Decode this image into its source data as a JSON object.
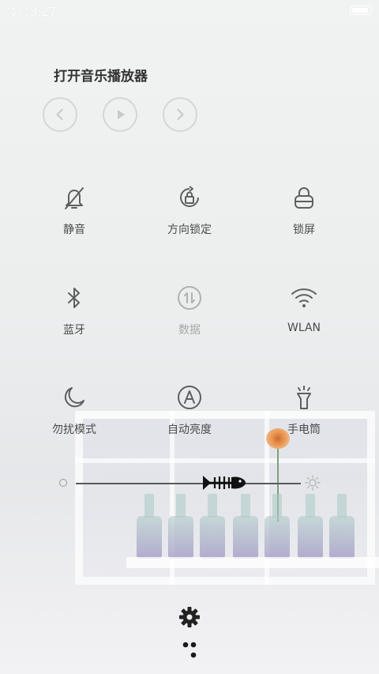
{
  "status_bar": {
    "time": "凌晨3:27",
    "battery_level": 1.0
  },
  "music": {
    "title": "打开音乐播放器",
    "controls": [
      {
        "name": "previous",
        "icon": "chevron-left-icon"
      },
      {
        "name": "play",
        "icon": "play-icon"
      },
      {
        "name": "next",
        "icon": "chevron-right-icon"
      }
    ]
  },
  "toggles": [
    {
      "label": "静音",
      "icon": "bell-off-icon",
      "enabled": true
    },
    {
      "label": "方向锁定",
      "icon": "rotation-lock-icon",
      "enabled": true
    },
    {
      "label": "锁屏",
      "icon": "lock-icon",
      "enabled": true
    },
    {
      "label": "蓝牙",
      "icon": "bluetooth-icon",
      "enabled": true
    },
    {
      "label": "数据",
      "icon": "mobile-data-icon",
      "enabled": false
    },
    {
      "label": "WLAN",
      "icon": "wifi-icon",
      "enabled": true
    },
    {
      "label": "勿扰模式",
      "icon": "moon-icon",
      "enabled": true
    },
    {
      "label": "自动亮度",
      "icon": "auto-brightness-icon",
      "enabled": true
    },
    {
      "label": "手电筒",
      "icon": "flashlight-icon",
      "enabled": true
    }
  ],
  "brightness": {
    "level": 0.66,
    "low_icon": "brightness-low-icon",
    "high_icon": "brightness-high-icon",
    "thumb_icon": "fish-bone-icon"
  },
  "bottom": {
    "settings_icon": "gear-icon",
    "more_icon": "dots-icon"
  },
  "colors": {
    "icon": "#5f5f5f",
    "icon_disabled": "#b0b0b0",
    "label": "#4a4a4a",
    "control_ring": "#d6d6d6"
  }
}
